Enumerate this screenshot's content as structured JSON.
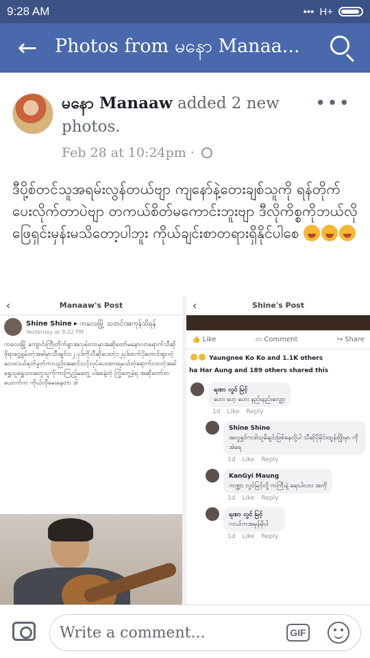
{
  "status_bar": {
    "time": "9:28 AM",
    "network": "H+"
  },
  "nav": {
    "title": "Photos from မနော Manaa..."
  },
  "post": {
    "author": "မနော Manaaw",
    "action": "added 2 new photos.",
    "timestamp": "Feb 28 at 10:24pm ·",
    "text": "ဒီပို့စ်တင်သူအရမ်းလွန်တယ်ဗျာ ကျနော်နဲ့တေးချစ်သူကို ရန်တိုက်ပေးလိုက်တာပဲဗျာ တကယ်စိတ်မကောင်းဘူးဗျာ ဒီလိုကိစ္စကိုဘယ်လိုဖြေရှင်းမှန်းမသိတော့ပါဘူး ကိုယ်ချင်းစာတရားရှိနိုင်ပါစေ"
  },
  "photo_left": {
    "header": "Manaaw's Post",
    "author": "Shine Shine",
    "author_suffix": "▸ ကလေးမြို့ သတင်းအကုန်သိရန်",
    "time": "Yesterday at 9:22 PM ·",
    "text": "ကလေးမြို့ ကျောင်းကြီးတိုက်ရွာအလှမ်းလာမှာအဆိုတော်မနောလာရောက်သီဆို ဖိုရာငွေ့ရှမ်းတဲ့အခါမှာသီးချင်း၁၂ ပုဒ်ကိုသီဆိုပေးတဲ့၁၂ပုဒ်ထက်ပိုတောင်းရှာတဲ့လေးလယ်ရတ်မှုတ်ကလည်းအဆင်သင့်လုပ်ပေးထားရမယ်တဲ့ရောက်လာတဲ့အခါရွှေသူရွှေသားတွေသူကိုကာကြည့်မတွေ့ ပါစေနဲ့တဲ့ ကြုံတွေ့ခဲ့ရ အဆိုတော်တယောက်က ကိုယ်လိုမေးနေတာ ဒါ"
  },
  "photo_right": {
    "header": "Shine's Post",
    "like": "Like",
    "comment": "Comment",
    "share": "Share",
    "reactions": "Yaungnee Ko Ko and 1.1K others",
    "shared": "ha Har Aung and 189 others shared this",
    "comments": [
      {
        "name": "ရဏာ လွင် မြင့်",
        "text": "ဟေး ဟေ့ ဟေး နည်းနည်းလျှော့",
        "meta_like": "Like",
        "meta_reply": "Reply",
        "meta_time": "1d"
      },
      {
        "name": "Shine Shine",
        "text": "အလှူရှင်ကဒါသူမိချင်းဖြစ်နေလို့ပါ သီဆိုပိုမိုင်းထွန်းဖြိုးမှာ ကိုအဲရေ",
        "meta_like": "Like",
        "meta_reply": "Reply",
        "meta_time": "1d"
      },
      {
        "name": "KanGyi Maung",
        "text": "ကဏ္ဍာ လွင်မြင့်လို့ ကကြီးနဲ့ ရေးပါလား အကို",
        "meta_like": "Like",
        "meta_reply": "Reply",
        "meta_time": "1d"
      },
      {
        "name": "ရဏာ လွင် မြင့်",
        "text": "ဂငယ်ကအမှန်မှိပါ",
        "meta_like": "Like",
        "meta_reply": "Reply",
        "meta_time": "1d"
      }
    ]
  },
  "comment_bar": {
    "placeholder": "Write a comment...",
    "gif": "GIF"
  }
}
